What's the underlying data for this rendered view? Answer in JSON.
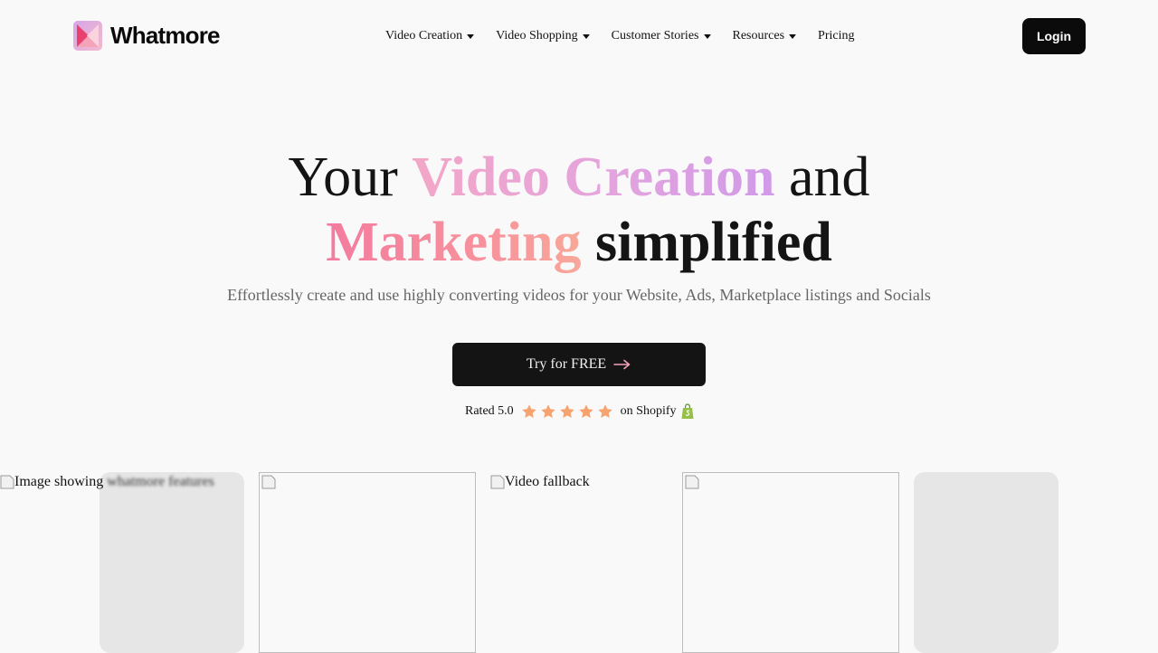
{
  "brand": {
    "name": "Whatmore",
    "logo_icon": "whatmore-logo-icon"
  },
  "nav": {
    "items": [
      {
        "label": "Video Creation",
        "has_dropdown": true
      },
      {
        "label": "Video Shopping",
        "has_dropdown": true
      },
      {
        "label": "Customer Stories",
        "has_dropdown": true
      },
      {
        "label": "Resources",
        "has_dropdown": true
      },
      {
        "label": "Pricing",
        "has_dropdown": false
      }
    ],
    "login_label": "Login"
  },
  "hero": {
    "title_line1_prefix": "Your",
    "title_line1_highlight": "Video Creation",
    "title_line1_suffix": "and",
    "title_line2_highlight": "Marketing",
    "title_line2_suffix": "simplified",
    "subtitle": "Effortlessly create and use highly converting videos for your Website, Ads, Marketplace listings and Socials",
    "cta_label": "Try for FREE",
    "cta_icon": "arrow-right-icon"
  },
  "rating": {
    "prefix": "Rated 5.0",
    "stars": 5,
    "suffix": "on Shopify",
    "platform_icon": "shopify-bag-icon"
  },
  "media": {
    "image_alt_1": "Image showing",
    "image_alt_1_blurred": "whatmore features",
    "video_fallback_alt": "Video fallback"
  },
  "colors": {
    "accent_pink": "#f47b9f",
    "accent_purple": "#d19ae8",
    "star_orange": "#f6a36f",
    "button_dark": "#141414",
    "background": "#f9f9f9"
  }
}
